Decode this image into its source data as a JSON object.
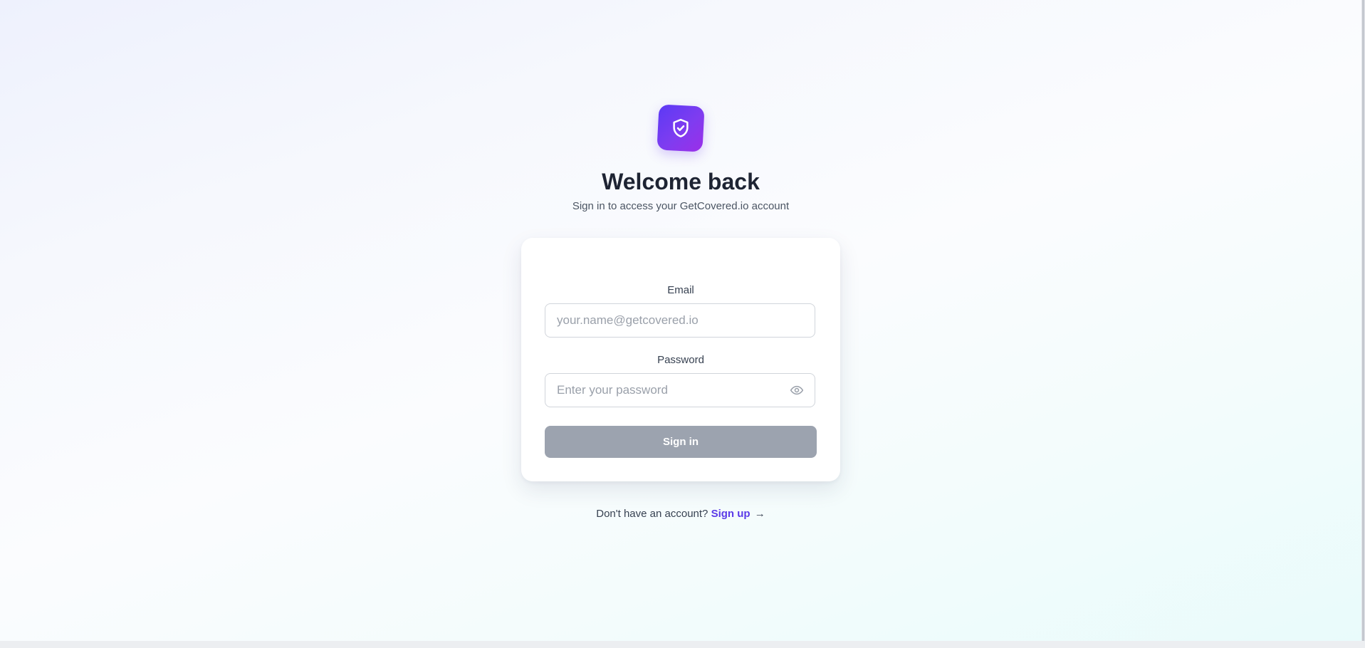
{
  "brand": {
    "logo_icon": "shield-check-icon",
    "gradient_start": "#5b3af5",
    "gradient_end": "#9b2fe8"
  },
  "header": {
    "title": "Welcome back",
    "subtitle": "Sign in to access your GetCovered.io account"
  },
  "form": {
    "email_label": "Email",
    "email_placeholder": "your.name@getcovered.io",
    "email_value": "",
    "password_label": "Password",
    "password_placeholder": "Enter your password",
    "password_value": "",
    "password_toggle_icon": "eye-icon",
    "submit_label": "Sign in",
    "submit_color": "#9ca3af"
  },
  "footer": {
    "prompt": "Don't have an account?",
    "signup_label": "Sign up",
    "signup_arrow": "→",
    "link_color": "#5b3ae8"
  }
}
